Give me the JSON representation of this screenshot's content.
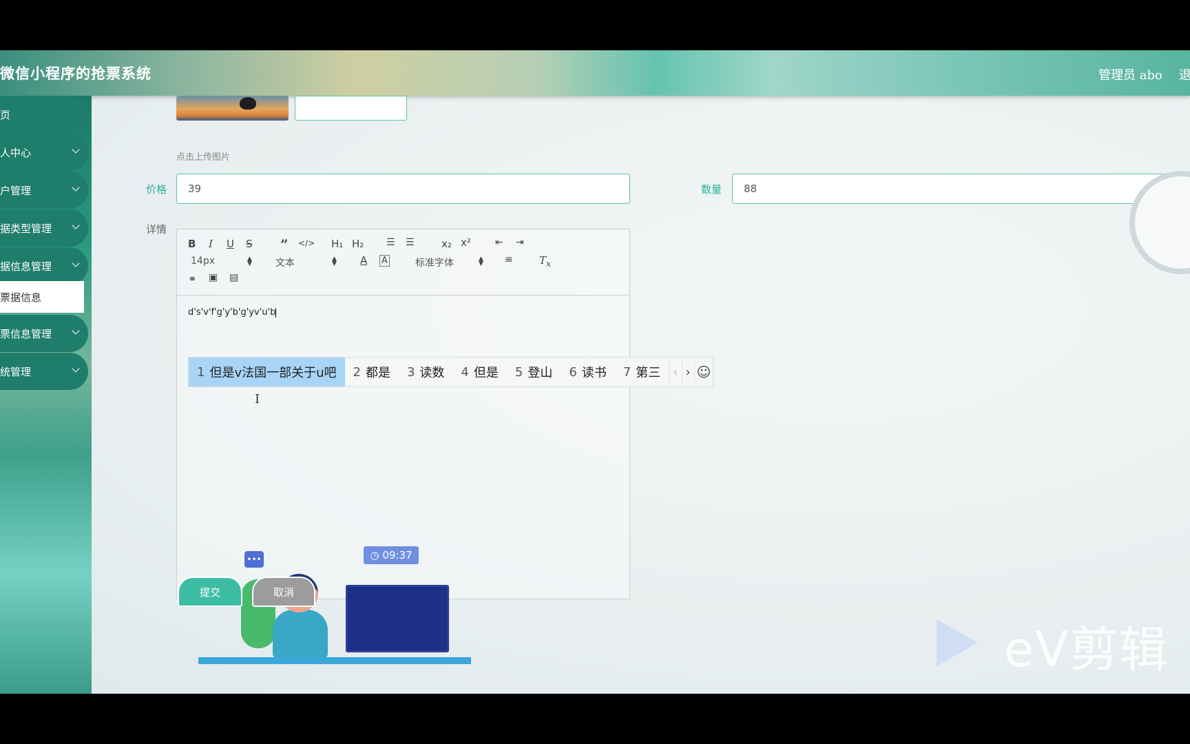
{
  "header": {
    "title": "微信小程序的抢票系统",
    "user": "管理员 abo",
    "logout": "退"
  },
  "sidebar": {
    "items": [
      {
        "label": "页",
        "has_chevron": false
      },
      {
        "label": "人中心",
        "has_chevron": true
      },
      {
        "label": "户管理",
        "has_chevron": true
      },
      {
        "label": "据类型管理",
        "has_chevron": true
      },
      {
        "label": "据信息管理",
        "has_chevron": true
      },
      {
        "label": "票信息管理",
        "has_chevron": true
      },
      {
        "label": "统管理",
        "has_chevron": true
      }
    ],
    "active_sub": "票据信息"
  },
  "form": {
    "upload_hint": "点击上传图片",
    "price_label": "价格",
    "price_value": "39",
    "quantity_label": "数量",
    "quantity_value": "88",
    "detail_label": "详情",
    "submit_label": "提交",
    "cancel_label": "取消"
  },
  "editor": {
    "font_size": "14px",
    "block_type": "文本",
    "font_family": "标准字体",
    "content": "d's'v'f'g'y'b'g'yv'u'b"
  },
  "ime": {
    "candidates": [
      {
        "num": "1",
        "text": "但是v法国一部关于u吧",
        "selected": true
      },
      {
        "num": "2",
        "text": "都是",
        "selected": false
      },
      {
        "num": "3",
        "text": "读数",
        "selected": false
      },
      {
        "num": "4",
        "text": "但是",
        "selected": false
      },
      {
        "num": "5",
        "text": "登山",
        "selected": false
      },
      {
        "num": "6",
        "text": "读书",
        "selected": false
      },
      {
        "num": "7",
        "text": "第三",
        "selected": false
      }
    ]
  },
  "illustration": {
    "clock_time": "09:37",
    "chat_dots": "•••"
  },
  "watermark": "eV剪辑",
  "colors": {
    "accent": "#2ab39a",
    "nav_bg": "#1f7d6b",
    "ime_selected": "#a8d4f7"
  }
}
